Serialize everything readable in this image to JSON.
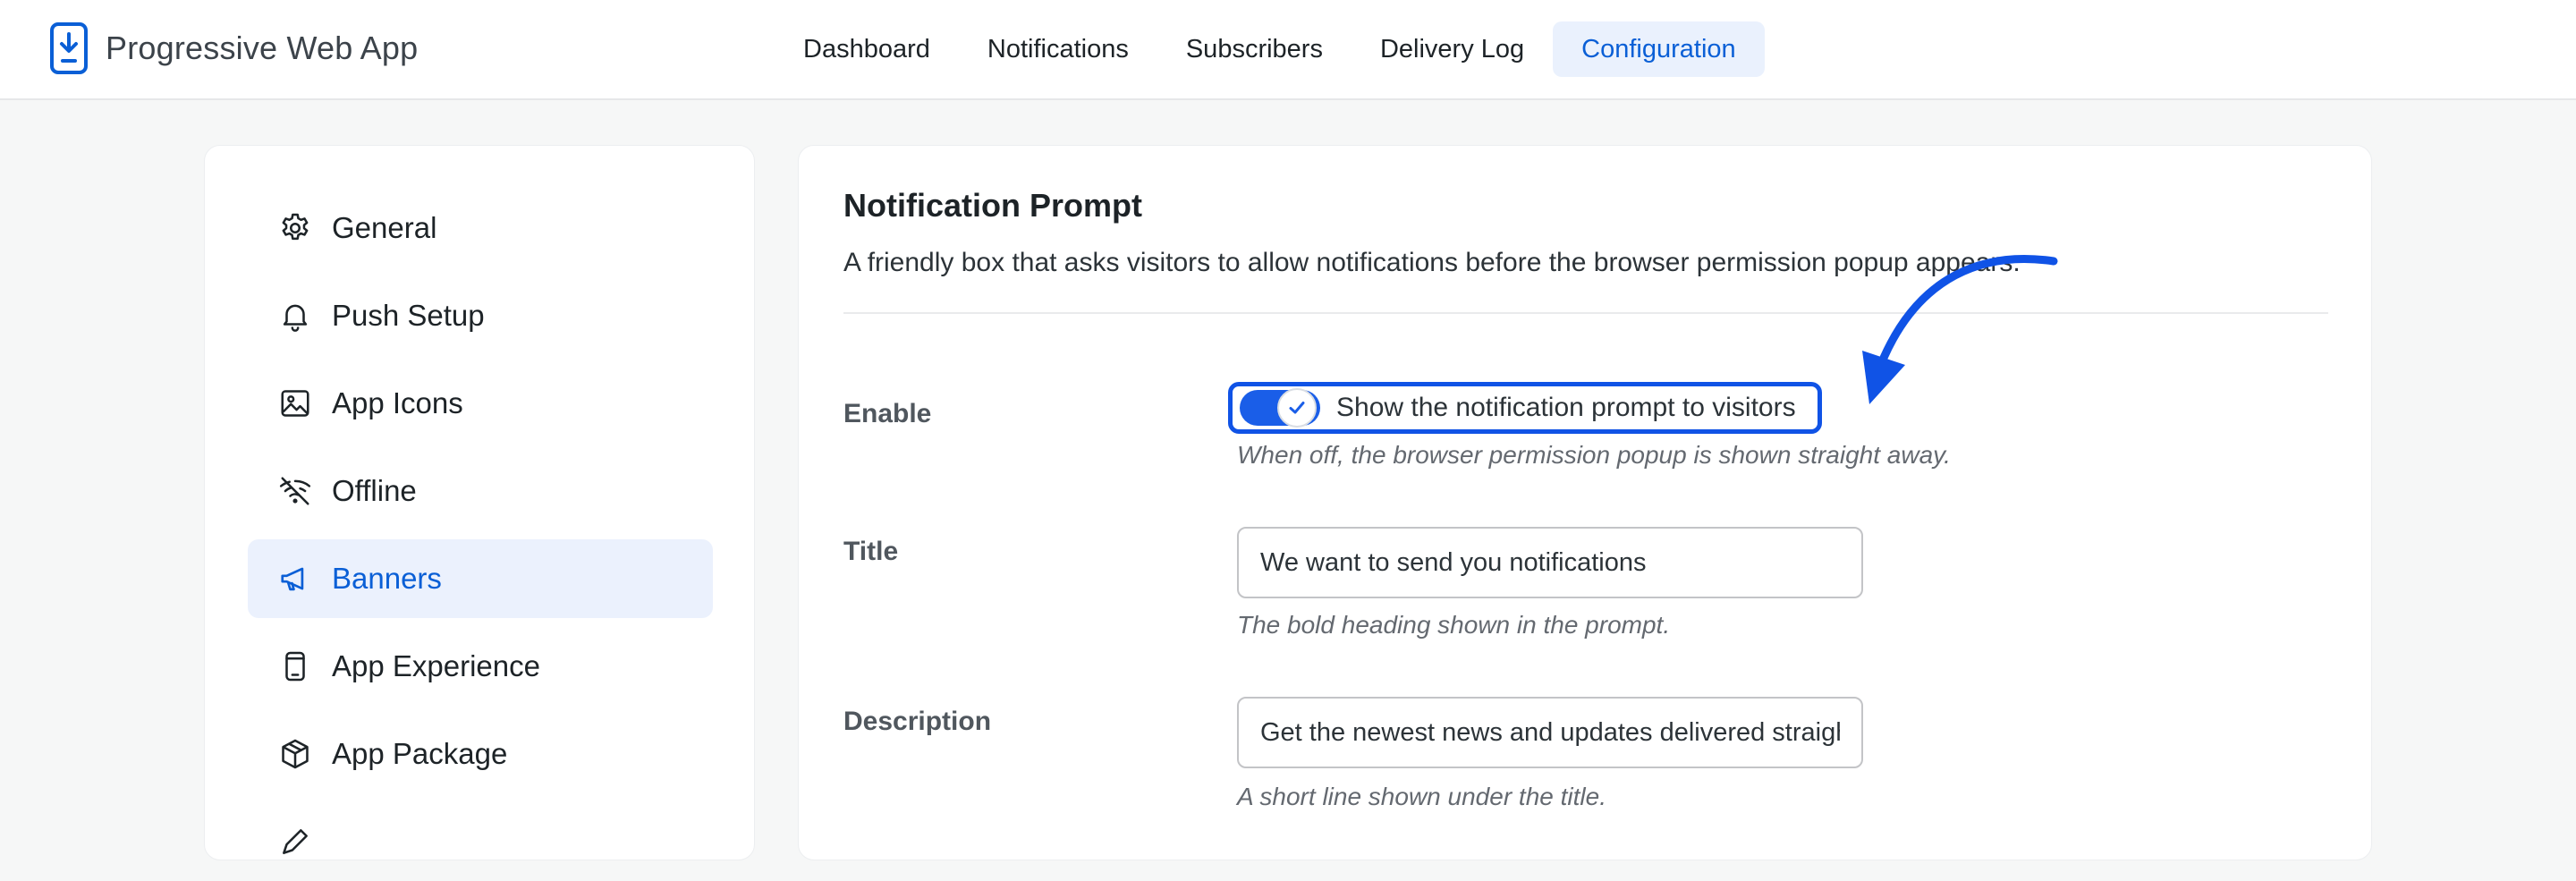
{
  "app": {
    "title": "Progressive Web App",
    "accent_color": "#0a5fd6"
  },
  "topnav": {
    "items": [
      {
        "label": "Dashboard",
        "active": false
      },
      {
        "label": "Notifications",
        "active": false
      },
      {
        "label": "Subscribers",
        "active": false
      },
      {
        "label": "Delivery Log",
        "active": false
      },
      {
        "label": "Configuration",
        "active": true
      }
    ]
  },
  "sidebar": {
    "items": [
      {
        "label": "General",
        "icon": "gear-icon",
        "active": false
      },
      {
        "label": "Push Setup",
        "icon": "bell-icon",
        "active": false
      },
      {
        "label": "App Icons",
        "icon": "image-icon",
        "active": false
      },
      {
        "label": "Offline",
        "icon": "wifi-off-icon",
        "active": false
      },
      {
        "label": "Banners",
        "icon": "megaphone-icon",
        "active": true
      },
      {
        "label": "App Experience",
        "icon": "phone-icon",
        "active": false
      },
      {
        "label": "App Package",
        "icon": "box-icon",
        "active": false
      }
    ]
  },
  "main": {
    "section_title": "Notification Prompt",
    "section_desc": "A friendly box that asks visitors to allow notifications before the browser permission popup appears.",
    "fields": {
      "enable": {
        "label": "Enable",
        "toggle_label": "Show the notification prompt to visitors",
        "checked": true,
        "help": "When off, the browser permission popup is shown straight away."
      },
      "title": {
        "label": "Title",
        "value": "We want to send you notifications",
        "help": "The bold heading shown in the prompt."
      },
      "description": {
        "label": "Description",
        "value": "Get the newest news and updates delivered straight to your device.",
        "help": "A short line shown under the title."
      }
    },
    "highlight_color": "#1053e6"
  }
}
